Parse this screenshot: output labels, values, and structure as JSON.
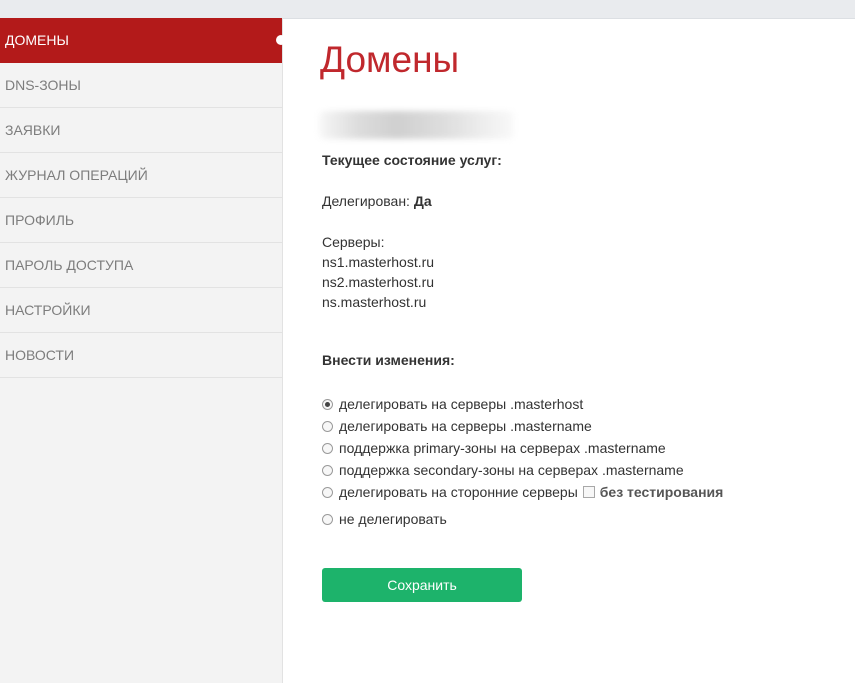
{
  "sidebar": {
    "items": [
      {
        "label": "ДОМЕНЫ",
        "active": true
      },
      {
        "label": "DNS-ЗОНЫ"
      },
      {
        "label": "ЗАЯВКИ"
      },
      {
        "label": "ЖУРНАЛ ОПЕРАЦИЙ"
      },
      {
        "label": "ПРОФИЛЬ"
      },
      {
        "label": "ПАРОЛЬ ДОСТУПА"
      },
      {
        "label": "НАСТРОЙКИ"
      },
      {
        "label": "НОВОСТИ"
      }
    ]
  },
  "main": {
    "title": "Домены",
    "current_state_heading": "Текущее состояние услуг:",
    "delegated_label": "Делегирован:",
    "delegated_value": "Да",
    "servers_label": "Серверы:",
    "servers": [
      "ns1.masterhost.ru",
      "ns2.masterhost.ru",
      "ns.masterhost.ru"
    ],
    "changes_heading": "Внести изменения:",
    "options": [
      {
        "label": "делегировать на серверы .masterhost",
        "selected": true
      },
      {
        "label": "делегировать на серверы .mastername",
        "selected": false
      },
      {
        "label": "поддержка primary-зоны на серверах .mastername",
        "selected": false
      },
      {
        "label": "поддержка secondary-зоны на серверах .mastername",
        "selected": false
      },
      {
        "label": "делегировать на сторонние серверы",
        "selected": false,
        "checkbox_label": "без тестирования",
        "checkbox_checked": false
      },
      {
        "label": "не делегировать",
        "selected": false
      }
    ],
    "save_label": "Сохранить"
  },
  "colors": {
    "accent_red": "#b31a1a",
    "title_red": "#c0282d",
    "save_green": "#1db36b"
  }
}
